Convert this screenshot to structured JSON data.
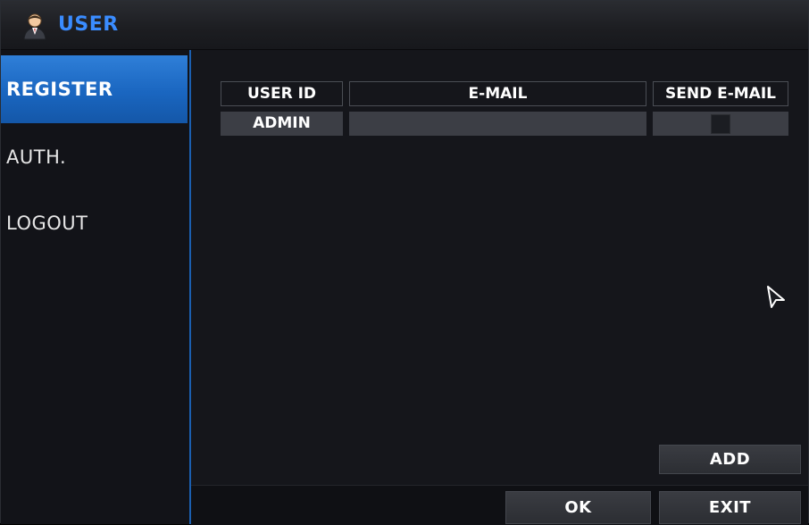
{
  "window": {
    "title": "USER",
    "title_icon": "user-person-icon",
    "accent_color": "#3a8cff"
  },
  "sidebar": {
    "items": [
      {
        "label": "REGISTER",
        "active": true
      },
      {
        "label": "AUTH.",
        "active": false
      },
      {
        "label": "LOGOUT",
        "active": false
      }
    ],
    "active_color": "#1a66c0"
  },
  "table": {
    "headers": [
      "USER ID",
      "E-MAIL",
      "SEND E-MAIL"
    ],
    "rows": [
      {
        "user_id": "ADMIN",
        "email": "",
        "send_email_checked": false
      }
    ]
  },
  "buttons": {
    "add": "ADD",
    "ok": "OK",
    "exit": "EXIT"
  },
  "cursor_icon": "mouse-pointer-icon"
}
